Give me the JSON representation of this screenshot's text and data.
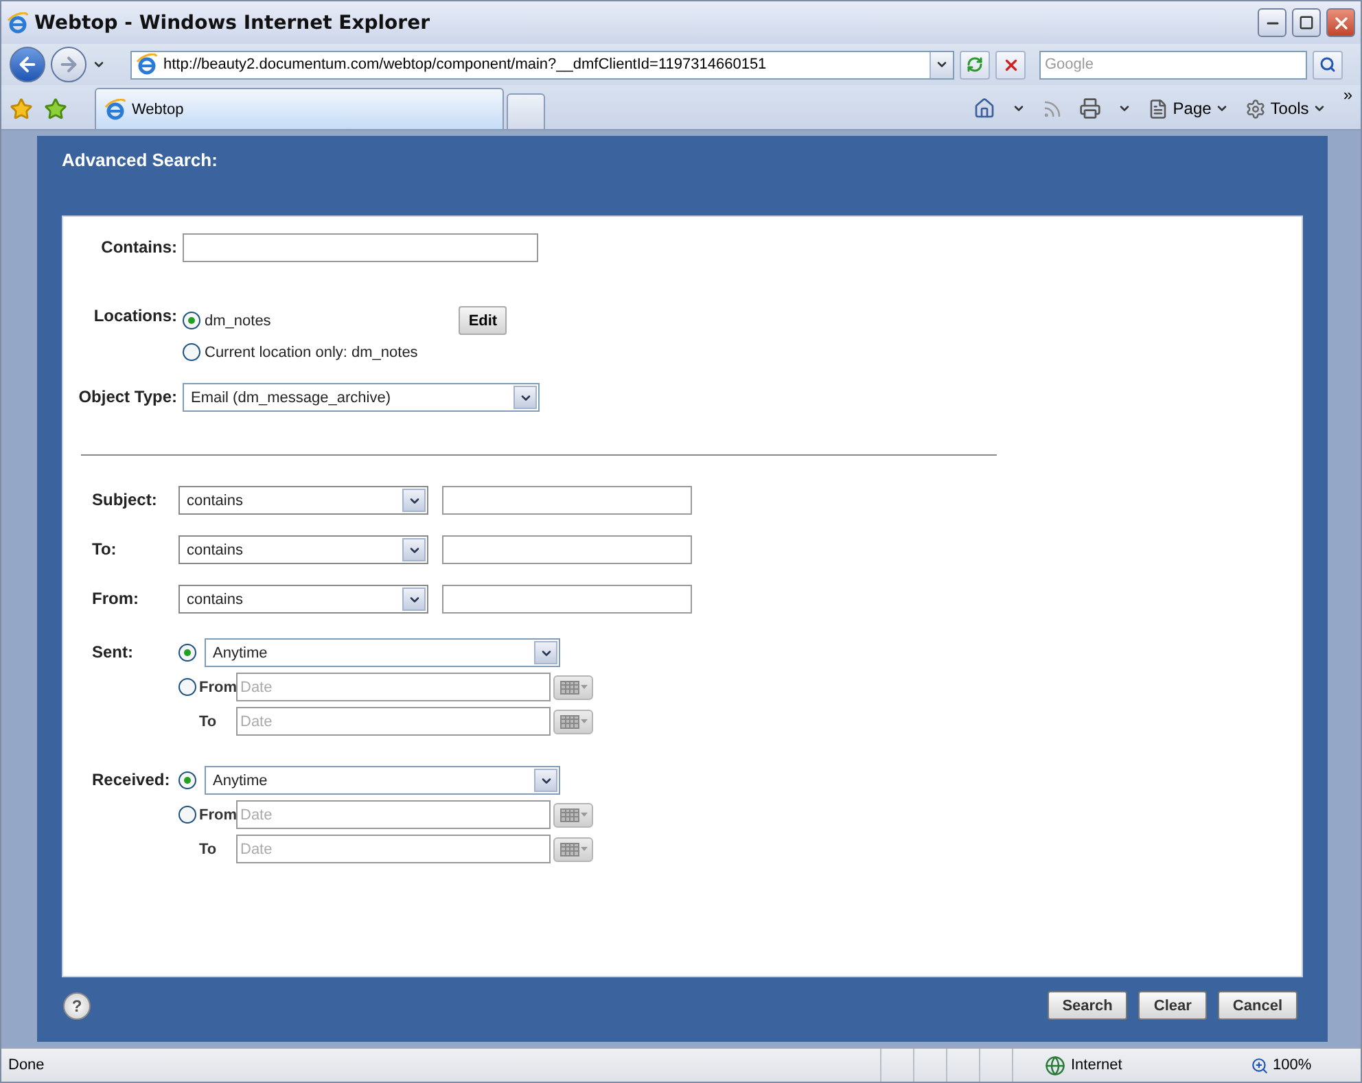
{
  "window": {
    "title": "Webtop - Windows Internet Explorer"
  },
  "address_bar": {
    "url": "http://beauty2.documentum.com/webtop/component/main?__dmfClientId=1197314660151",
    "search_placeholder": "Google"
  },
  "tabs": [
    {
      "label": "Webtop",
      "selected": true
    }
  ],
  "command_bar": [
    {
      "label": "Page",
      "kind": "page"
    },
    {
      "label": "Tools",
      "kind": "tools"
    }
  ],
  "chevron": "»",
  "panel": {
    "title": "Advanced Search:",
    "contains": {
      "label": "Contains:"
    },
    "locations": {
      "label": "Locations:",
      "options": [
        {
          "label": "dm_notes",
          "selected": true
        },
        {
          "label": "Current location only: dm_notes",
          "selected": false
        }
      ],
      "edit_button": "Edit"
    },
    "object_type": {
      "label": "Object Type:",
      "value": "Email (dm_message_archive)"
    },
    "criteria": [
      {
        "label": "Subject:",
        "operator": "contains"
      },
      {
        "label": "To:",
        "operator": "contains"
      },
      {
        "label": "From:",
        "operator": "contains"
      }
    ],
    "date_filters": [
      {
        "label": "Sent:",
        "anytime": {
          "value": "Anytime",
          "selected": true
        },
        "from": {
          "label": "From",
          "placeholder": "Date",
          "selected": false
        },
        "to": {
          "label": "To",
          "placeholder": "Date"
        }
      },
      {
        "label": "Received:",
        "anytime": {
          "value": "Anytime",
          "selected": true
        },
        "from": {
          "label": "From",
          "placeholder": "Date",
          "selected": false
        },
        "to": {
          "label": "To",
          "placeholder": "Date"
        }
      }
    ],
    "help": "?",
    "buttons": [
      "Search",
      "Clear",
      "Cancel"
    ]
  },
  "status_bar": {
    "text": "Done",
    "zone": "Internet",
    "zoom": "100%"
  }
}
